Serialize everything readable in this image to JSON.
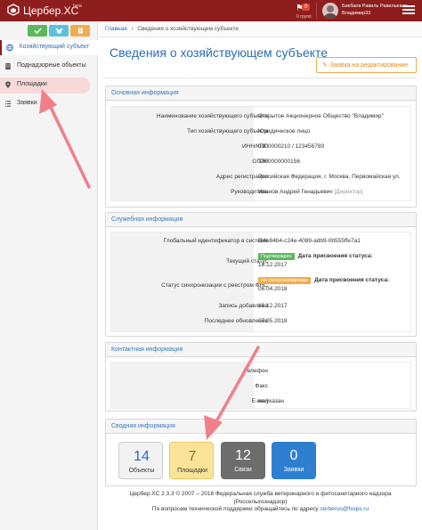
{
  "header": {
    "brand": "Цербер.XC",
    "beta": "beta",
    "notifications_count": "0",
    "group_label": "0 групп",
    "user_name": "Бикбаев Равиль Равильевич",
    "user_login": "Владимир33"
  },
  "sidebar": {
    "quick_buttons": [
      "check-icon",
      "dog-icon",
      "document-icon"
    ],
    "items": [
      {
        "label": "Хозяйствующий субъект",
        "icon": "globe-icon"
      },
      {
        "label": "Поднадзорные объекты",
        "icon": "building-icon"
      },
      {
        "label": "Площадки",
        "icon": "map-marker-icon"
      },
      {
        "label": "Заявки",
        "icon": "list-icon"
      }
    ]
  },
  "breadcrumb": {
    "home": "Главная",
    "current": "Сведения о хозяйствующем субъекте"
  },
  "page": {
    "title": "Сведения о хозяйствующем субъекте",
    "edit_button": "Заявка на редактирование"
  },
  "basic_info": {
    "title": "Основная информация",
    "rows": [
      {
        "label": "Наименование хозяйствующего субъекта",
        "value": "Открытое Акционерное Общество \"Владимир\""
      },
      {
        "label": "Тип хозяйствующего субъекта",
        "value": "Юридическое лицо"
      },
      {
        "label": "ИНН/КПП",
        "value": "0300000210 / 123456789"
      },
      {
        "label": "ОГРН",
        "value": "1300000000156"
      },
      {
        "label": "Адрес регистрации",
        "value": "Российская Федерация, г. Москва, Первомайская ул."
      },
      {
        "label": "Руководитель",
        "value": "Иванов Андрей Генадьевич",
        "note": "[Директор]"
      }
    ]
  },
  "service_info": {
    "title": "Служебная информация",
    "guid_label": "Глобальный идентификатор в системе",
    "guid": "f24e84b4-c24e-4089-adb9-0b555ffe7a1",
    "status_label": "Текущий статус",
    "status_tag": "Подтвержден",
    "status_date_label": "Дата присвоения статуса:",
    "status_date": "18.12.2017",
    "sync_label": "Статус синхронизации с реестром ФНС",
    "sync_tag": "Не синхронизирован",
    "sync_date_label": "Дата присвоения статуса:",
    "sync_date": "06.04.2018",
    "added_label": "Запись добавлена",
    "added": "18.12.2017",
    "updated_label": "Последнее обновление",
    "updated": "07.05.2018"
  },
  "contact_info": {
    "title": "Контактная информация",
    "phone_label": "Телефон",
    "fax_label": "Факс",
    "email_label": "E-mail",
    "email_value": "не указан"
  },
  "summary": {
    "title": "Сводная информация",
    "tiles": [
      {
        "count": "14",
        "label": "Объекты",
        "color": "#f2f2f2"
      },
      {
        "count": "7",
        "label": "Площадки",
        "color": "#fbe39a"
      },
      {
        "count": "12",
        "label": "Связи",
        "color": "#6d6d6d"
      },
      {
        "count": "0",
        "label": "Заявки",
        "color": "#2f7fd0"
      }
    ]
  },
  "footer": {
    "line1": "Цербер.XC 2.3.3 © 2007 – 2018 Федеральная служба ветеринарного и фитосанитарного надзора",
    "line2": "(Россельхознадзор)",
    "line3_prefix": "По вопросам технической поддержки обращайтесь по адресу",
    "support_email": "cerberus@fsvps.ru"
  },
  "colors": {
    "header": "#8e1d1d",
    "accent": "#2a6db5",
    "annotation_arrow": "#f07f8a"
  }
}
